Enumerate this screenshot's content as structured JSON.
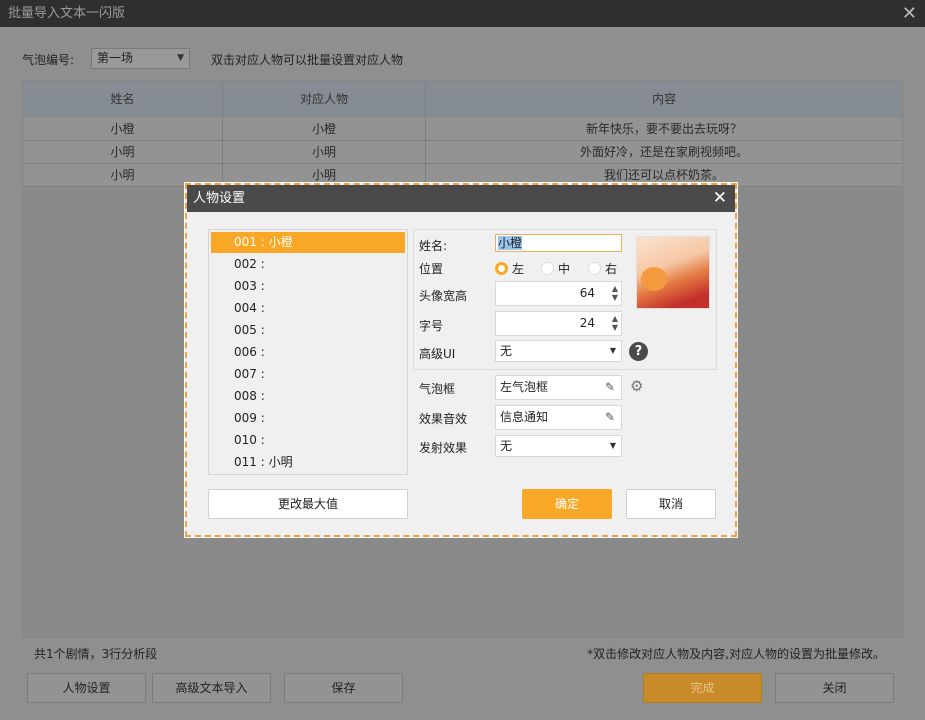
{
  "window": {
    "title": "批量导入文本一闪版",
    "close_icon": "✕"
  },
  "toolbar": {
    "bubble_label": "气泡编号:",
    "bubble_value": "第一场",
    "hint": "双击对应人物可以批量设置对应人物"
  },
  "table": {
    "headers": [
      "姓名",
      "对应人物",
      "内容"
    ],
    "rows": [
      [
        "小橙",
        "小橙",
        "新年快乐，要不要出去玩呀？"
      ],
      [
        "小明",
        "小明",
        "外面好冷，还是在家刷视频吧。"
      ],
      [
        "小明",
        "小明",
        "我们还可以点杯奶茶。"
      ]
    ]
  },
  "footer": {
    "summary": "共1个剧情，3行分析段",
    "note": "*双击修改对应人物及内容,对应人物的设置为批量修改。",
    "buttons": {
      "character": "人物设置",
      "advanced_import": "高级文本导入",
      "save": "保存",
      "done": "完成",
      "close": "关闭"
    }
  },
  "dialog": {
    "title": "人物设置",
    "close_icon": "✕",
    "list": [
      "001 : 小橙",
      "002 :",
      "003 :",
      "004 :",
      "005 :",
      "006 :",
      "007 :",
      "008 :",
      "009 :",
      "010 :",
      "011 : 小明"
    ],
    "name_label": "姓名:",
    "name_value": "小橙",
    "position_label": "位置",
    "positions": [
      "左",
      "中",
      "右"
    ],
    "position_selected": "左",
    "avatar_size_label": "头像宽高",
    "avatar_size": "64",
    "font_size_label": "字号",
    "font_size": "24",
    "advanced_ui_label": "高级UI",
    "advanced_ui_value": "无",
    "bubble_frame_label": "气泡框",
    "bubble_frame_value": "左气泡框",
    "sound_label": "效果音效",
    "sound_value": "信息通知",
    "emit_label": "发射效果",
    "emit_value": "无",
    "change_max_button": "更改最大值",
    "ok_button": "确定",
    "cancel_button": "取消"
  },
  "colors": {
    "accent": "#f8a726",
    "title_bar": "#4a4a4a"
  }
}
